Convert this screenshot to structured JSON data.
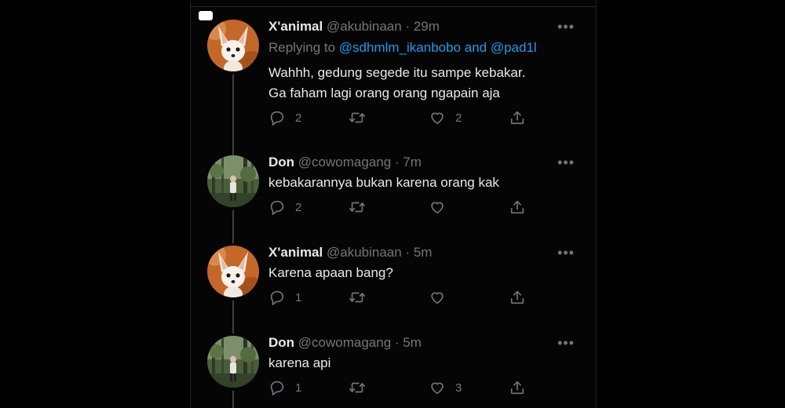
{
  "colors": {
    "background": "#000000",
    "text": "#e7e9ea",
    "muted": "#71767b",
    "link": "#1d9bf0",
    "thread_line": "#3e4144"
  },
  "tweets": [
    {
      "name": "X'animal",
      "handle": "@akubinaan",
      "time": "· 29m",
      "replying_prefix": "Replying to",
      "replying_to": "@sdhmlm_ikanbobo and @pad1l",
      "lines": [
        "Wahhh, gedung segede itu sampe kebakar.",
        "Ga faham lagi orang orang ngapain aja"
      ],
      "reply_count": "2",
      "retweet_count": "",
      "like_count": "2",
      "avatar": "fennec-fox-avatar"
    },
    {
      "name": "Don",
      "handle": "@cowomagang",
      "time": "· 7m",
      "lines": [
        "kebakarannya bukan karena orang kak"
      ],
      "reply_count": "2",
      "retweet_count": "",
      "like_count": "",
      "avatar": "forest-person-avatar"
    },
    {
      "name": "X'animal",
      "handle": "@akubinaan",
      "time": "· 5m",
      "lines": [
        "Karena apaan bang?"
      ],
      "reply_count": "1",
      "retweet_count": "",
      "like_count": "",
      "avatar": "fennec-fox-avatar"
    },
    {
      "name": "Don",
      "handle": "@cowomagang",
      "time": "· 5m",
      "lines": [
        "karena api"
      ],
      "reply_count": "1",
      "retweet_count": "",
      "like_count": "3",
      "avatar": "forest-person-avatar"
    }
  ],
  "more_label": "•••"
}
